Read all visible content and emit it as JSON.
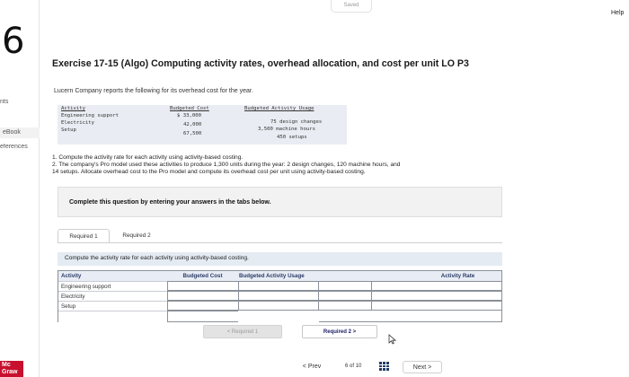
{
  "header": {
    "saved_label": "Saved",
    "help_label": "Help"
  },
  "left_rail": {
    "question_number": "6",
    "items": [
      {
        "label": "nts"
      },
      {
        "label": "eBook"
      },
      {
        "label": "eferences"
      }
    ],
    "logo_text": "Mc Graw"
  },
  "exercise": {
    "title": "Exercise 17-15 (Algo) Computing activity rates, overhead allocation, and cost per unit LO P3",
    "intro": "Lucern Company reports the following for its overhead cost for the year."
  },
  "data_table": {
    "headers": {
      "activity": "Activity",
      "cost": "Budgeted Cost",
      "usage": "Budgeted Activity Usage"
    },
    "rows": [
      {
        "activity": "Engineering support",
        "cost": "$ 33,000",
        "usage": "75 design changes"
      },
      {
        "activity": "Electricity",
        "cost": "42,000",
        "usage": "3,500 machine hours"
      },
      {
        "activity": "Setup",
        "cost": "67,500",
        "usage": "450 setups"
      }
    ]
  },
  "instructions": {
    "q1": "1. Compute the activity rate for each activity using activity-based costing.",
    "q2_line1": "2. The company's Pro model used these activities to produce 1,300 units during the year: 2 design changes, 120 machine hours, and",
    "q2_line2": "14 setups. Allocate overhead cost to the Pro model and compute its overhead cost per unit using activity-based costing."
  },
  "complete_box": {
    "text": "Complete this question by entering your answers in the tabs below."
  },
  "tabs": [
    {
      "label": "Required 1"
    },
    {
      "label": "Required 2"
    }
  ],
  "required1": {
    "prompt": "Compute the activity rate for each activity using activity-based costing.",
    "columns": {
      "activity": "Activity",
      "cost": "Budgeted Cost",
      "usage": "Budgeted Activity Usage",
      "rate": "Activity Rate"
    },
    "rows": [
      {
        "activity": "Engineering support"
      },
      {
        "activity": "Electricity"
      },
      {
        "activity": "Setup"
      }
    ]
  },
  "nav": {
    "prev_required": "Required 1",
    "next_required": "Required 2",
    "prev_label": "Prev",
    "page_current": "6",
    "page_of": "of",
    "page_total": "10",
    "next_label": "Next"
  },
  "colors": {
    "accent": "#1f3b66",
    "header_bg": "#e8edf5",
    "prompt_bg": "#e4ebf3",
    "logo_red": "#c8102e"
  }
}
